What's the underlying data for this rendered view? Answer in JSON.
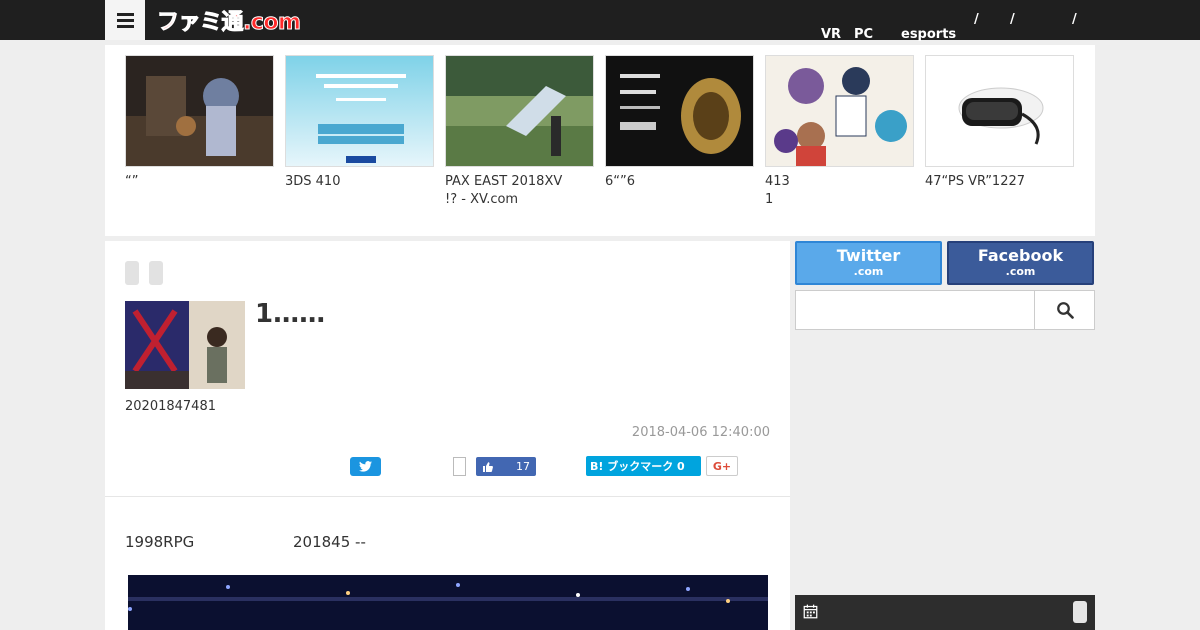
{
  "header": {
    "logo_text": "ファミ通.com",
    "nav": [
      {
        "label": "VR"
      },
      {
        "label": "PC"
      },
      {
        "label": "esports"
      },
      {
        "label": "/"
      },
      {
        "label": "/"
      },
      {
        "label": "/"
      }
    ]
  },
  "carousel": {
    "items": [
      {
        "caption": "“”",
        "icon": "game-scene-thumbnail"
      },
      {
        "caption": "3DS 410",
        "icon": "atlus-announcement-thumbnail"
      },
      {
        "caption": "PAX EAST 2018XV\n!? - XV.com",
        "icon": "landscape-thumbnail"
      },
      {
        "caption": "6“”6",
        "icon": "ring-thumbnail"
      },
      {
        "caption": " 413\n1",
        "icon": "anime-thumbnail"
      },
      {
        "caption": "47“PS VR”1227",
        "icon": "vr-headset-thumbnail"
      }
    ]
  },
  "article": {
    "headline": "1……",
    "byline": "20201847481",
    "date": "2018-04-06 12:40:00",
    "like_count": "17",
    "hatena_label": "B! ブックマーク 0",
    "gplus_label": "G+",
    "lead_a": "1998RPG",
    "lead_b": "201845 --"
  },
  "sidebar": {
    "twitter": {
      "name": "Twitter",
      "sub": ".com"
    },
    "facebook": {
      "name": "Facebook",
      "sub": ".com"
    },
    "search_placeholder": ""
  },
  "colors": {
    "header_bg": "#1f1f1f",
    "logo_red": "#ff2a2a",
    "twitter_blue": "#5aa9ea",
    "facebook_blue": "#3b5b9a",
    "hatena_blue": "#00a4de"
  }
}
